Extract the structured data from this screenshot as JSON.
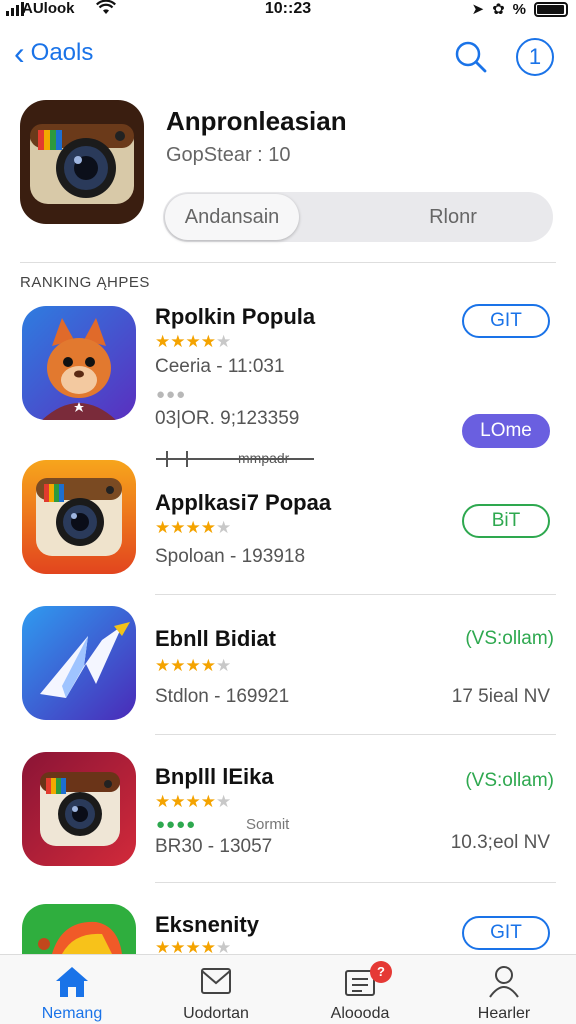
{
  "status": {
    "carrier": "AUlook",
    "time": "10::23",
    "battery_percent": "%",
    "battery_level": 0.95
  },
  "nav": {
    "back_label": "Oaols"
  },
  "app": {
    "title": "Anpronleasian",
    "subtitle": "GopStear : 10"
  },
  "segment": {
    "option1": "Andansain",
    "option2": "Rlonr"
  },
  "section": {
    "label": "RANKING ĄHPES"
  },
  "rows": [
    {
      "name": "Rpolkin Popula",
      "meta": "Ceeria - 11:031",
      "meta2": "03|OR. 9;123359",
      "rating": 4,
      "button": "GIT",
      "button2": "LOme",
      "progress_label": "mmpadr"
    },
    {
      "name": "Applkasi7 Popaa",
      "meta": "Spoloan - 193918",
      "rating": 4,
      "button": "BiT"
    },
    {
      "name": "Ebnll Bidiat",
      "meta": "Stdlon - 169921",
      "rating": 4,
      "price": "(VS:ollam)",
      "size": "17 5ieal NV"
    },
    {
      "name": "Bnplll lEika",
      "meta": "BR30 - 13057",
      "rating": 4,
      "price": "(VS:ollam)",
      "size": "10.3;eol NV",
      "dots_label": "Sormit"
    },
    {
      "name": "Eksnenity",
      "rating": 4,
      "button": "GIT"
    }
  ],
  "tabs": [
    {
      "label": "Nemang",
      "icon": "home-icon",
      "active": true
    },
    {
      "label": "Uodortan",
      "icon": "envelope-icon"
    },
    {
      "label": "Aloooda",
      "icon": "updates-icon",
      "badge": "?"
    },
    {
      "label": "Hearler",
      "icon": "profile-icon"
    }
  ],
  "colors": {
    "accent": "#1a73e8",
    "green": "#2ea84f",
    "purple": "#6a5fe0",
    "star": "#f4a300",
    "badge": "#e53935"
  }
}
